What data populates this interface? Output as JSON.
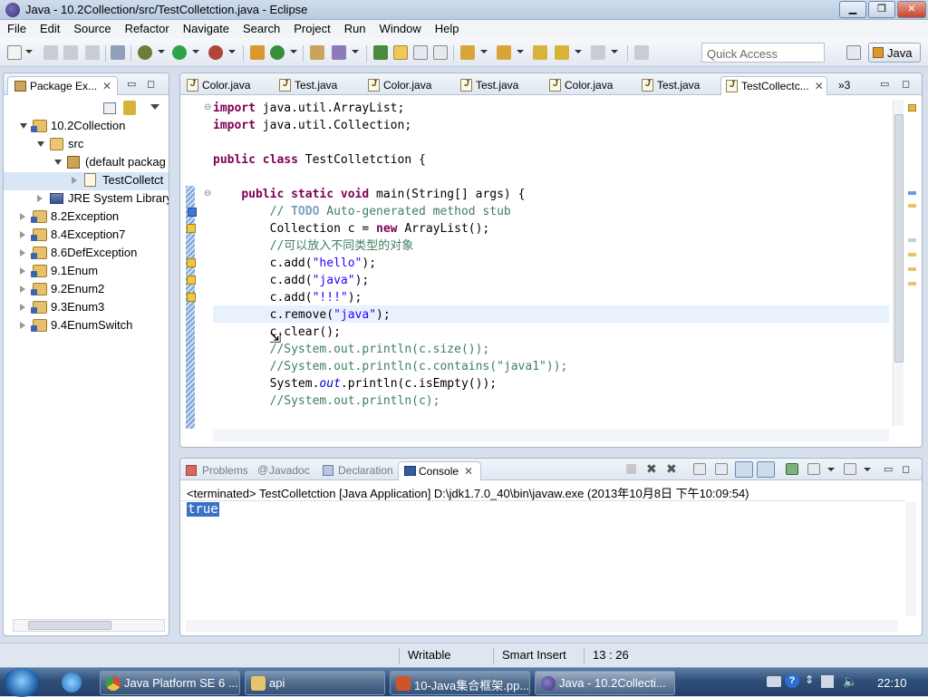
{
  "window": {
    "title": "Java - 10.2Collection/src/TestColletction.java - Eclipse"
  },
  "menu": [
    "File",
    "Edit",
    "Source",
    "Refactor",
    "Navigate",
    "Search",
    "Project",
    "Run",
    "Window",
    "Help"
  ],
  "quick_access": {
    "placeholder": "Quick Access"
  },
  "perspective": {
    "label": "Java"
  },
  "package_explorer": {
    "title": "Package Ex...",
    "tree": [
      {
        "label": "10.2Collection",
        "level": 0,
        "expanded": true,
        "icon": "project-icon"
      },
      {
        "label": "src",
        "level": 1,
        "expanded": true,
        "icon": "source-folder-icon"
      },
      {
        "label": "(default packag",
        "level": 2,
        "expanded": true,
        "icon": "package-icon"
      },
      {
        "label": "TestColletct",
        "level": 3,
        "expanded": false,
        "icon": "java-file-icon",
        "selected": true
      },
      {
        "label": "JRE System Library",
        "level": 1,
        "expanded": false,
        "icon": "library-icon"
      },
      {
        "label": "8.2Exception",
        "level": 0,
        "expanded": false,
        "icon": "project-icon"
      },
      {
        "label": "8.4Exception7",
        "level": 0,
        "expanded": false,
        "icon": "project-icon"
      },
      {
        "label": "8.6DefException",
        "level": 0,
        "expanded": false,
        "icon": "project-icon"
      },
      {
        "label": "9.1Enum",
        "level": 0,
        "expanded": false,
        "icon": "project-icon"
      },
      {
        "label": "9.2Enum2",
        "level": 0,
        "expanded": false,
        "icon": "project-icon"
      },
      {
        "label": "9.3Enum3",
        "level": 0,
        "expanded": false,
        "icon": "project-icon"
      },
      {
        "label": "9.4EnumSwitch",
        "level": 0,
        "expanded": false,
        "icon": "project-icon"
      }
    ]
  },
  "editor": {
    "tabs": [
      "Color.java",
      "Test.java",
      "Color.java",
      "Test.java",
      "Color.java",
      "Test.java",
      "TestCollectc..."
    ],
    "active_tab": 6,
    "overflow": "»3",
    "code": {
      "l1_kw": "import",
      "l1_rest": " java.util.ArrayList;",
      "l2_kw": "import",
      "l2_rest": " java.util.Collection;",
      "l4_kw1": "public",
      "l4_kw2": "class",
      "l4_rest": " TestColletction {",
      "l6_kw1": "public",
      "l6_kw2": "static",
      "l6_kw3": "void",
      "l6_rest": " main(String[] args) {",
      "l7_a": "// ",
      "l7_todo": "TODO",
      "l7_b": " Auto-generated method stub",
      "l8_a": "Collection c = ",
      "l8_kw": "new",
      "l8_b": " ArrayList();",
      "l9": "//可以放入不同类型的对象",
      "l10_a": "c.add(",
      "l10_s": "\"hello\"",
      "l10_b": ");",
      "l11_a": "c.add(",
      "l11_s": "\"java\"",
      "l11_b": ");",
      "l12_a": "c.add(",
      "l12_s": "\"!!!\"",
      "l12_b": ");",
      "l13_a": "c.remove(",
      "l13_s": "\"java\"",
      "l13_b": ");",
      "l14": "c.clear();",
      "l15": "//System.out.println(c.size());",
      "l16": "//System.out.println(c.contains(\"java1\"));",
      "l17_a": "System.",
      "l17_it": "out",
      "l17_b": ".println(c.isEmpty());",
      "l18": "//System.out.println(c);"
    }
  },
  "console_panel": {
    "tabs": [
      "Problems",
      "Javadoc",
      "Declaration",
      "Console"
    ],
    "active_tab": 3,
    "header": "<terminated> TestColletction [Java Application] D:\\jdk1.7.0_40\\bin\\javaw.exe (2013年10月8日 下午10:09:54)",
    "output": "true"
  },
  "status": {
    "writable": "Writable",
    "insert_mode": "Smart Insert",
    "position": "13 : 26"
  },
  "taskbar": {
    "items": [
      "Java Platform SE 6 ...",
      "api",
      "10-Java集合框架.pp...",
      "Java - 10.2Collecti..."
    ],
    "clock": "22:10"
  }
}
